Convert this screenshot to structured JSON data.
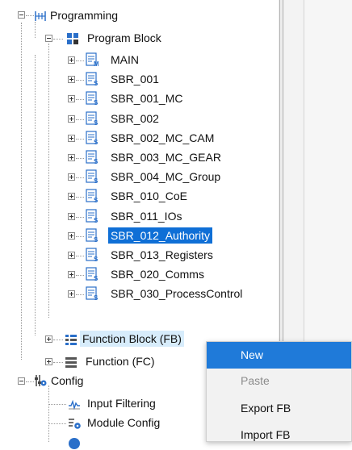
{
  "tree": {
    "programming": "Programming",
    "program_block": "Program Block",
    "blocks": [
      "MAIN",
      "SBR_001",
      "SBR_001_MC",
      "SBR_002",
      "SBR_002_MC_CAM",
      "SBR_003_MC_GEAR",
      "SBR_004_MC_Group",
      "SBR_010_CoE",
      "SBR_011_IOs",
      "SBR_012_Authority",
      "SBR_013_Registers",
      "SBR_020_Comms",
      "SBR_030_ProcessControl"
    ],
    "selected_block": "SBR_012_Authority",
    "function_block": "Function Block (FB)",
    "function": "Function (FC)",
    "config": "Config",
    "config_items": [
      "Input Filtering",
      "Module Config"
    ]
  },
  "context_menu": {
    "items": [
      "New",
      "Paste",
      "Export FB",
      "Import FB"
    ],
    "highlighted": "New",
    "disabled": [
      "Paste"
    ]
  },
  "colors": {
    "selection": "#0f6fd6",
    "menu_highlight": "#1f7ad9",
    "hover": "#d7ecfb"
  }
}
